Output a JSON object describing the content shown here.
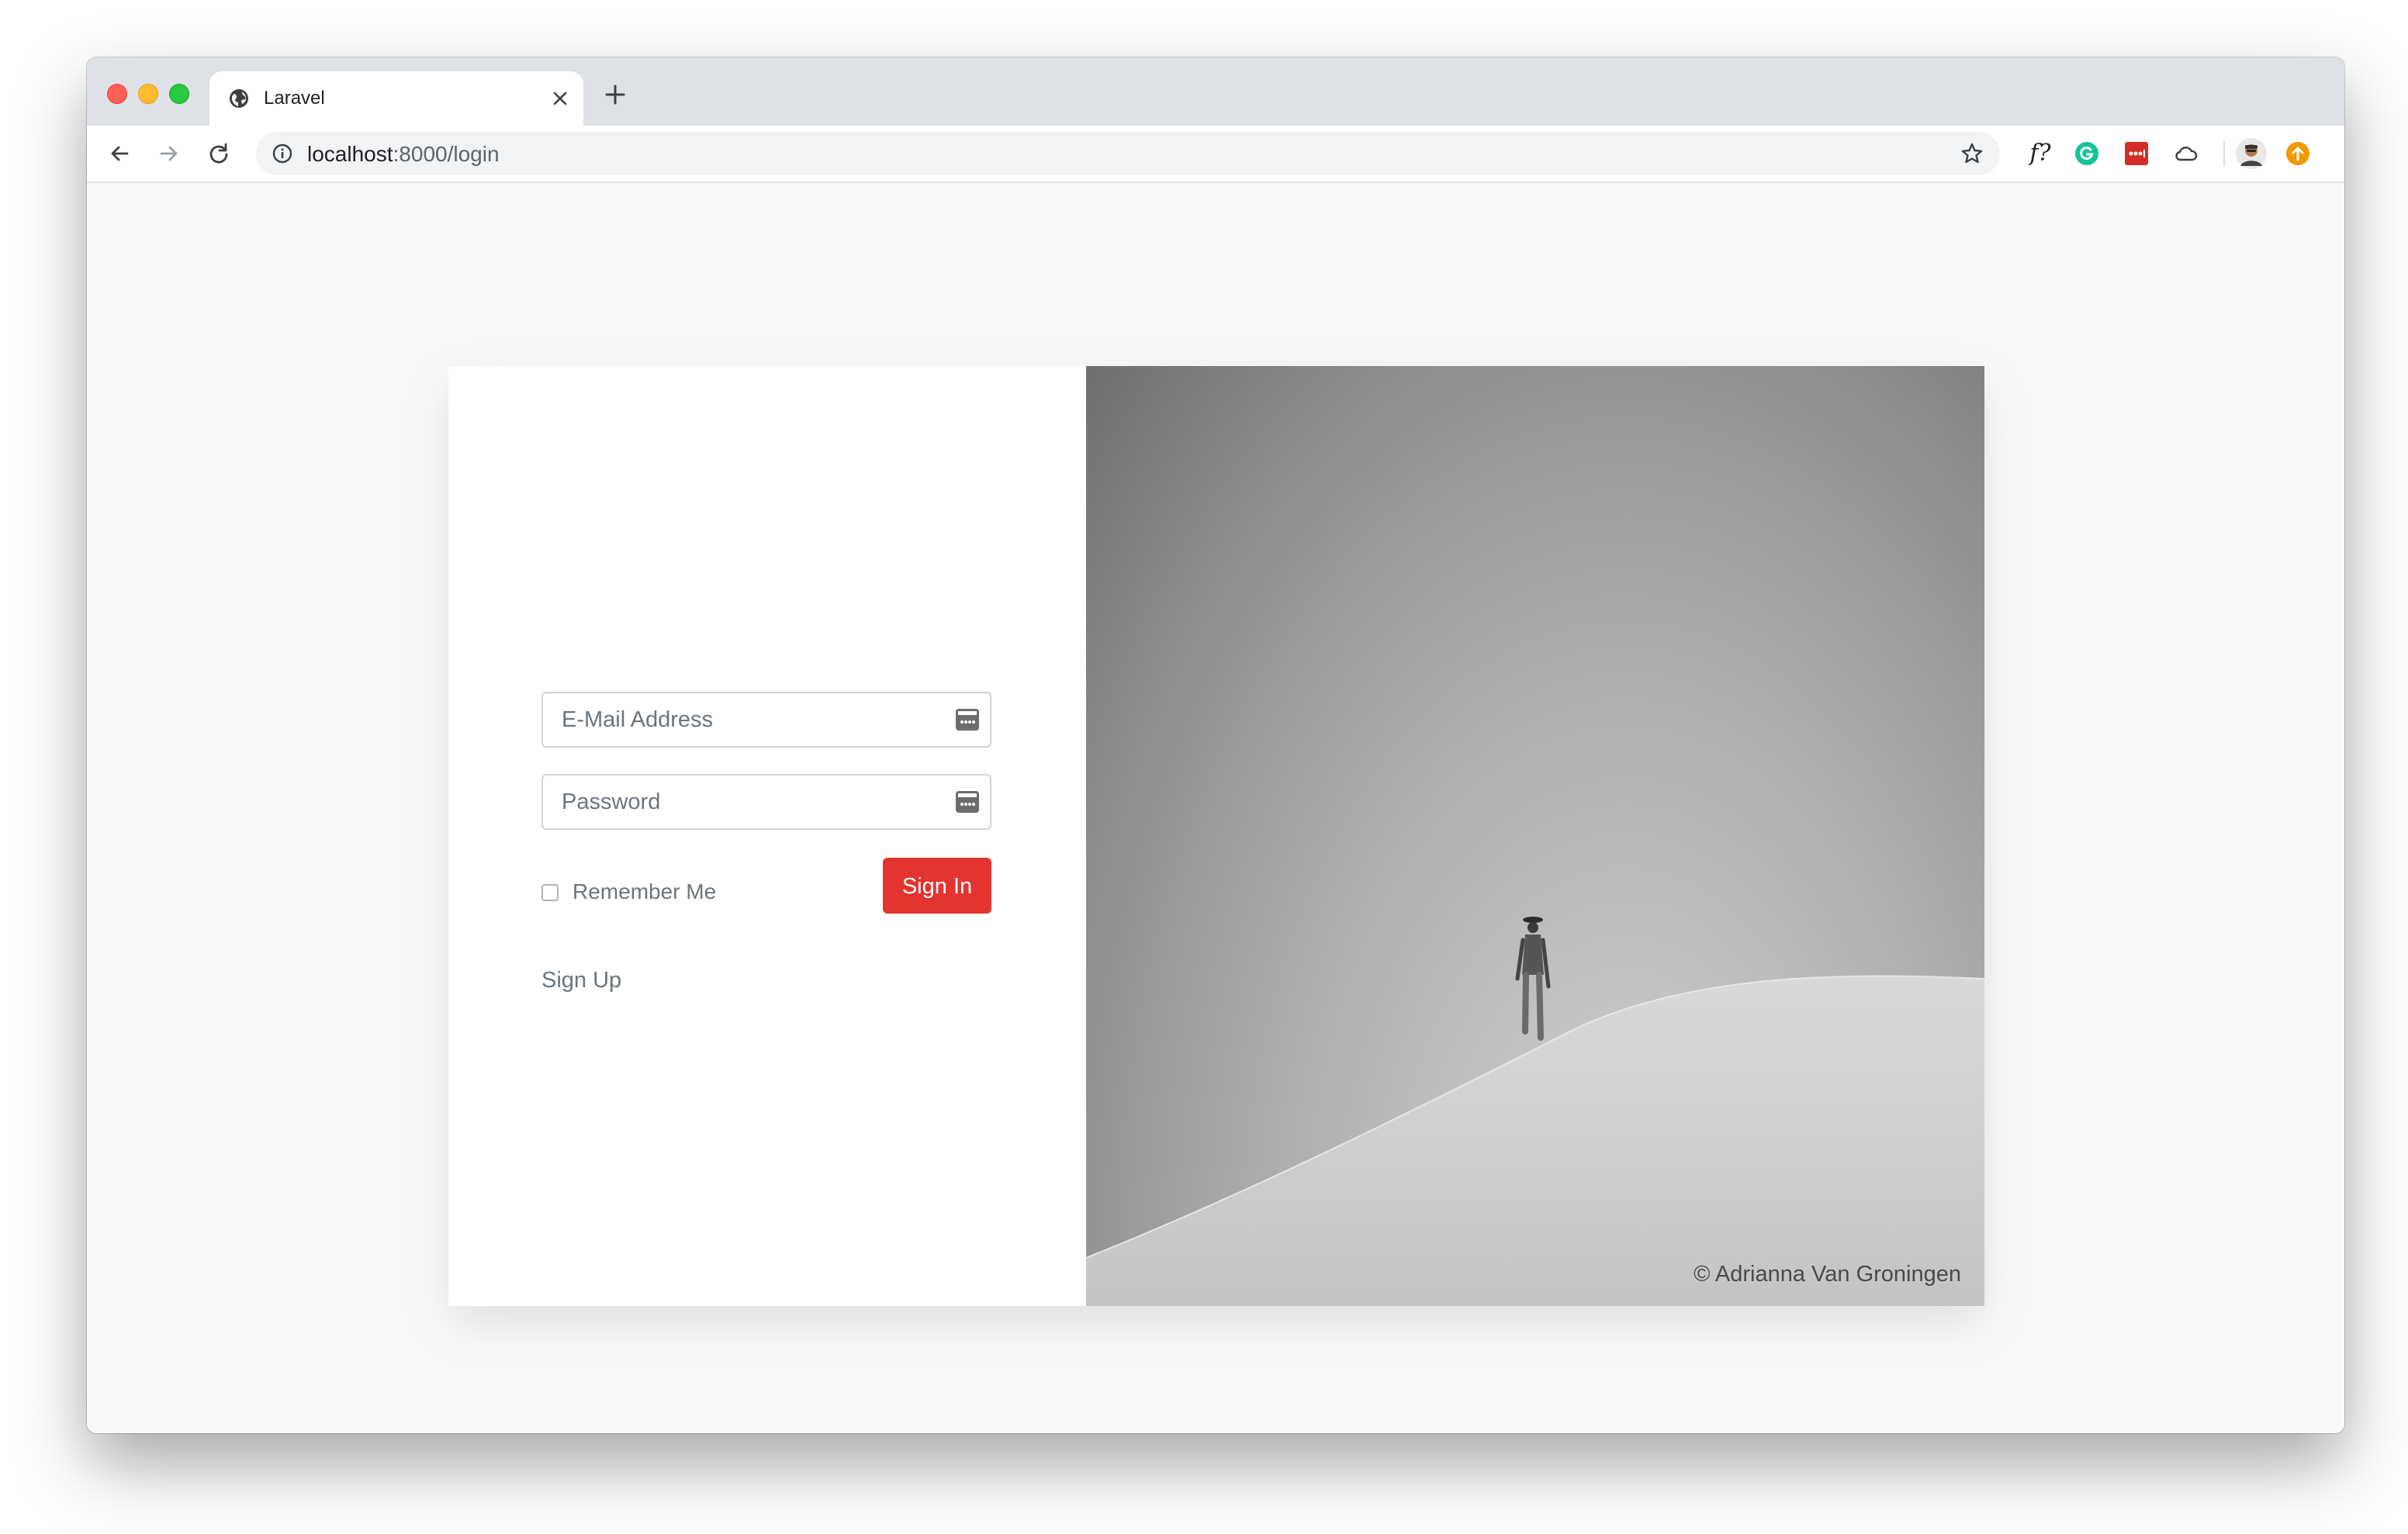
{
  "browser": {
    "tab_title": "Laravel",
    "tab_close_icon": "close-icon",
    "new_tab_icon": "plus-icon",
    "url_host": "localhost",
    "url_rest": ":8000/login",
    "nav_icons": [
      "back-arrow-icon",
      "forward-arrow-icon",
      "reload-icon"
    ],
    "extension_label": "f?",
    "extensions": [
      "fonts-ninja-icon",
      "grammarly-icon",
      "lastpass-icon",
      "cloud-icon",
      "profile-avatar",
      "update-icon"
    ]
  },
  "login": {
    "email_placeholder": "E-Mail Address",
    "password_placeholder": "Password",
    "remember_label": "Remember Me",
    "signin_label": "Sign In",
    "signup_label": "Sign Up"
  },
  "photo": {
    "credit": "© Adrianna Van Groningen"
  },
  "colors": {
    "accent": "#e3342f",
    "page_bg": "#f8f9fb",
    "chrome_tabstrip": "#dee1e6"
  }
}
